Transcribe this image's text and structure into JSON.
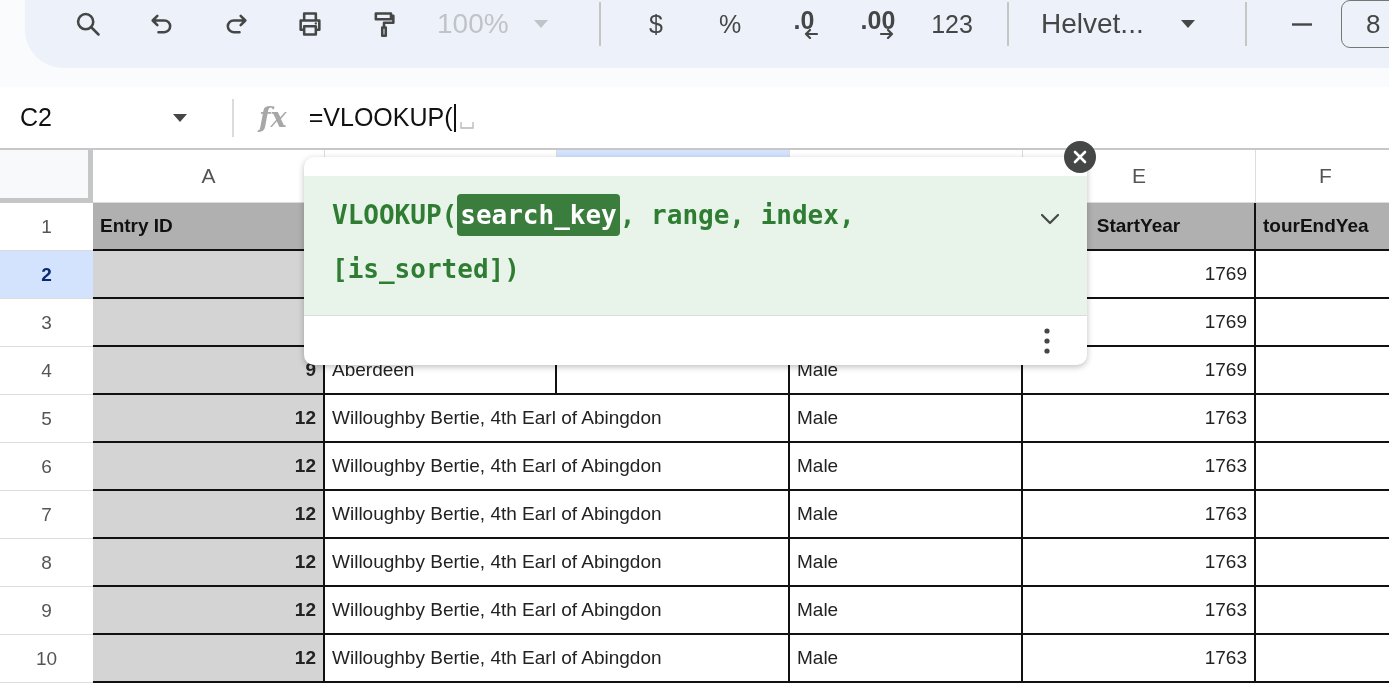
{
  "toolbar": {
    "items": [
      {
        "kind": "search"
      },
      {
        "kind": "undo"
      },
      {
        "kind": "redo"
      },
      {
        "kind": "print"
      },
      {
        "kind": "paint"
      },
      {
        "kind": "zoom",
        "value": "100%",
        "disabled": true
      },
      {
        "kind": "divider"
      },
      {
        "kind": "text",
        "label": "$"
      },
      {
        "kind": "text",
        "label": "%"
      },
      {
        "kind": "decrease",
        "label": ".0"
      },
      {
        "kind": "increase",
        "label": ".00"
      },
      {
        "kind": "text",
        "label": "123"
      },
      {
        "kind": "divider"
      },
      {
        "kind": "font",
        "value": "Helvet..."
      },
      {
        "kind": "divider"
      },
      {
        "kind": "minus"
      },
      {
        "kind": "size",
        "value": "8"
      }
    ]
  },
  "formula_bar": {
    "cell_ref": "C2",
    "fx_label": "fx",
    "formula": "=VLOOKUP("
  },
  "grid": {
    "columns": [
      {
        "letter": "A",
        "selected": false
      },
      {
        "selected": false
      },
      {
        "selected": true
      },
      {
        "selected": false
      },
      {
        "letter": "E",
        "selected": false
      },
      {
        "letter": "F",
        "selected": false
      }
    ],
    "rows": [
      {
        "header": "1",
        "selected": false,
        "kind": "header",
        "cells": [
          "Entry ID",
          null,
          null,
          null,
          "StartYear",
          "tourEndYea"
        ]
      },
      {
        "header": "2",
        "selected": true,
        "kind": "data",
        "cells": [
          null,
          null,
          null,
          null,
          "1769",
          null
        ]
      },
      {
        "header": "3",
        "selected": false,
        "kind": "data",
        "cells": [
          null,
          null,
          null,
          null,
          "1769",
          null
        ]
      },
      {
        "header": "4",
        "selected": false,
        "kind": "data",
        "cells": [
          "9",
          "Aberdeen",
          null,
          "Male",
          "1769",
          null
        ]
      },
      {
        "header": "5",
        "selected": false,
        "kind": "data",
        "cells": [
          "12",
          "Willoughby Bertie, 4th Earl of Abingdon",
          null,
          "Male",
          "1763",
          null
        ]
      },
      {
        "header": "6",
        "selected": false,
        "kind": "data",
        "cells": [
          "12",
          "Willoughby Bertie, 4th Earl of Abingdon",
          null,
          "Male",
          "1763",
          null
        ]
      },
      {
        "header": "7",
        "selected": false,
        "kind": "data",
        "cells": [
          "12",
          "Willoughby Bertie, 4th Earl of Abingdon",
          null,
          "Male",
          "1763",
          null
        ]
      },
      {
        "header": "8",
        "selected": false,
        "kind": "data",
        "cells": [
          "12",
          "Willoughby Bertie, 4th Earl of Abingdon",
          null,
          "Male",
          "1763",
          null
        ]
      },
      {
        "header": "9",
        "selected": false,
        "kind": "data",
        "cells": [
          "12",
          "Willoughby Bertie, 4th Earl of Abingdon",
          null,
          "Male",
          "1763",
          null
        ]
      },
      {
        "header": "10",
        "selected": false,
        "kind": "data",
        "cells": [
          "12",
          "Willoughby Bertie, 4th Earl of Abingdon",
          null,
          "Male",
          "1763",
          null
        ]
      }
    ]
  },
  "popup": {
    "signature": [
      {
        "text": "VLOOKUP(",
        "selected": false
      },
      {
        "text": "search_key",
        "selected": true
      },
      {
        "text": ", range, index, [is_sorted])",
        "selected": false
      }
    ],
    "expanded": false
  }
}
